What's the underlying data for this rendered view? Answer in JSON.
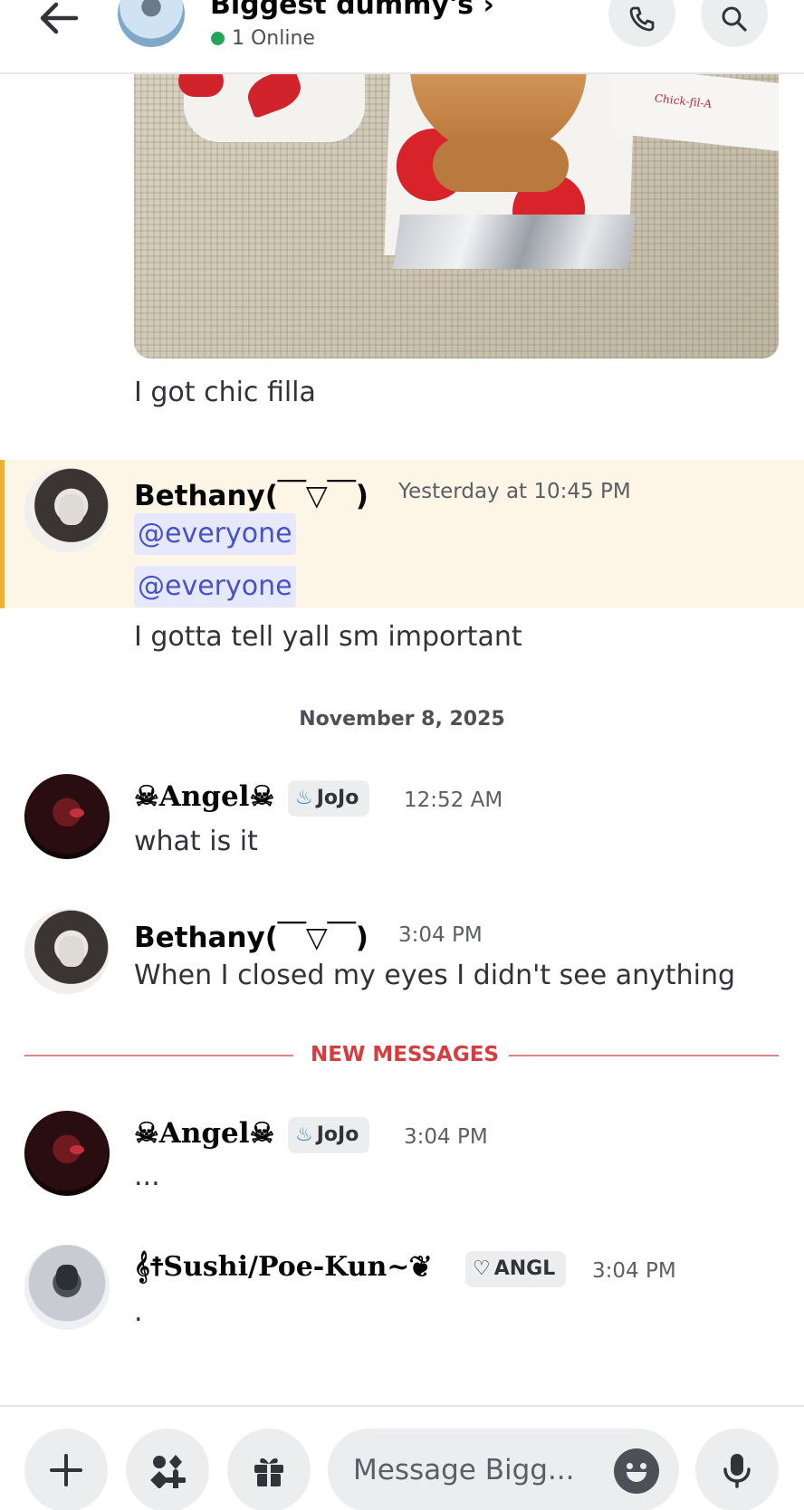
{
  "header": {
    "title": "Biggest dummy's",
    "online_text": "1 Online"
  },
  "attachment": {
    "logo_text": "Chick-fil-A"
  },
  "messages": [
    {
      "id": "m1",
      "text": "I got chic filla"
    },
    {
      "id": "m2",
      "author": "Bethany(￣▽￣)",
      "timestamp": "Yesterday at 10:45 PM",
      "highlighted": true,
      "mentions": [
        "@everyone",
        "@everyone"
      ],
      "text": "I gotta tell yall sm important"
    }
  ],
  "date_divider": "November 8, 2025",
  "messages2": [
    {
      "id": "m3",
      "author": "☠Angel☠",
      "tag": "JoJo",
      "tag_icon": "flame-icon",
      "timestamp": "12:52 AM",
      "text": "what is it"
    },
    {
      "id": "m4",
      "author": "Bethany(￣▽￣)",
      "timestamp": "3:04 PM",
      "text": "When I closed my eyes I didn't see anything"
    }
  ],
  "new_messages_label": "NEW MESSAGES",
  "messages3": [
    {
      "id": "m5",
      "author": "☠Angel☠",
      "tag": "JoJo",
      "tag_icon": "flame-icon",
      "timestamp": "3:04 PM",
      "text": "..."
    },
    {
      "id": "m6",
      "author": "𝄞☨Sushi/Poe-Kun~❦",
      "tag": "ANGL",
      "tag_icon": "heart-outline-icon",
      "timestamp": "3:04 PM",
      "text": "."
    }
  ],
  "composer": {
    "placeholder": "Message Bigg..."
  },
  "colors": {
    "mention_bg": "#e6e8fd",
    "mention_text": "#4752c4",
    "highlight_bg": "#fdf6e6",
    "highlight_bar": "#f0b132",
    "new_messages": "#d83c3e",
    "online": "#23a55a"
  }
}
